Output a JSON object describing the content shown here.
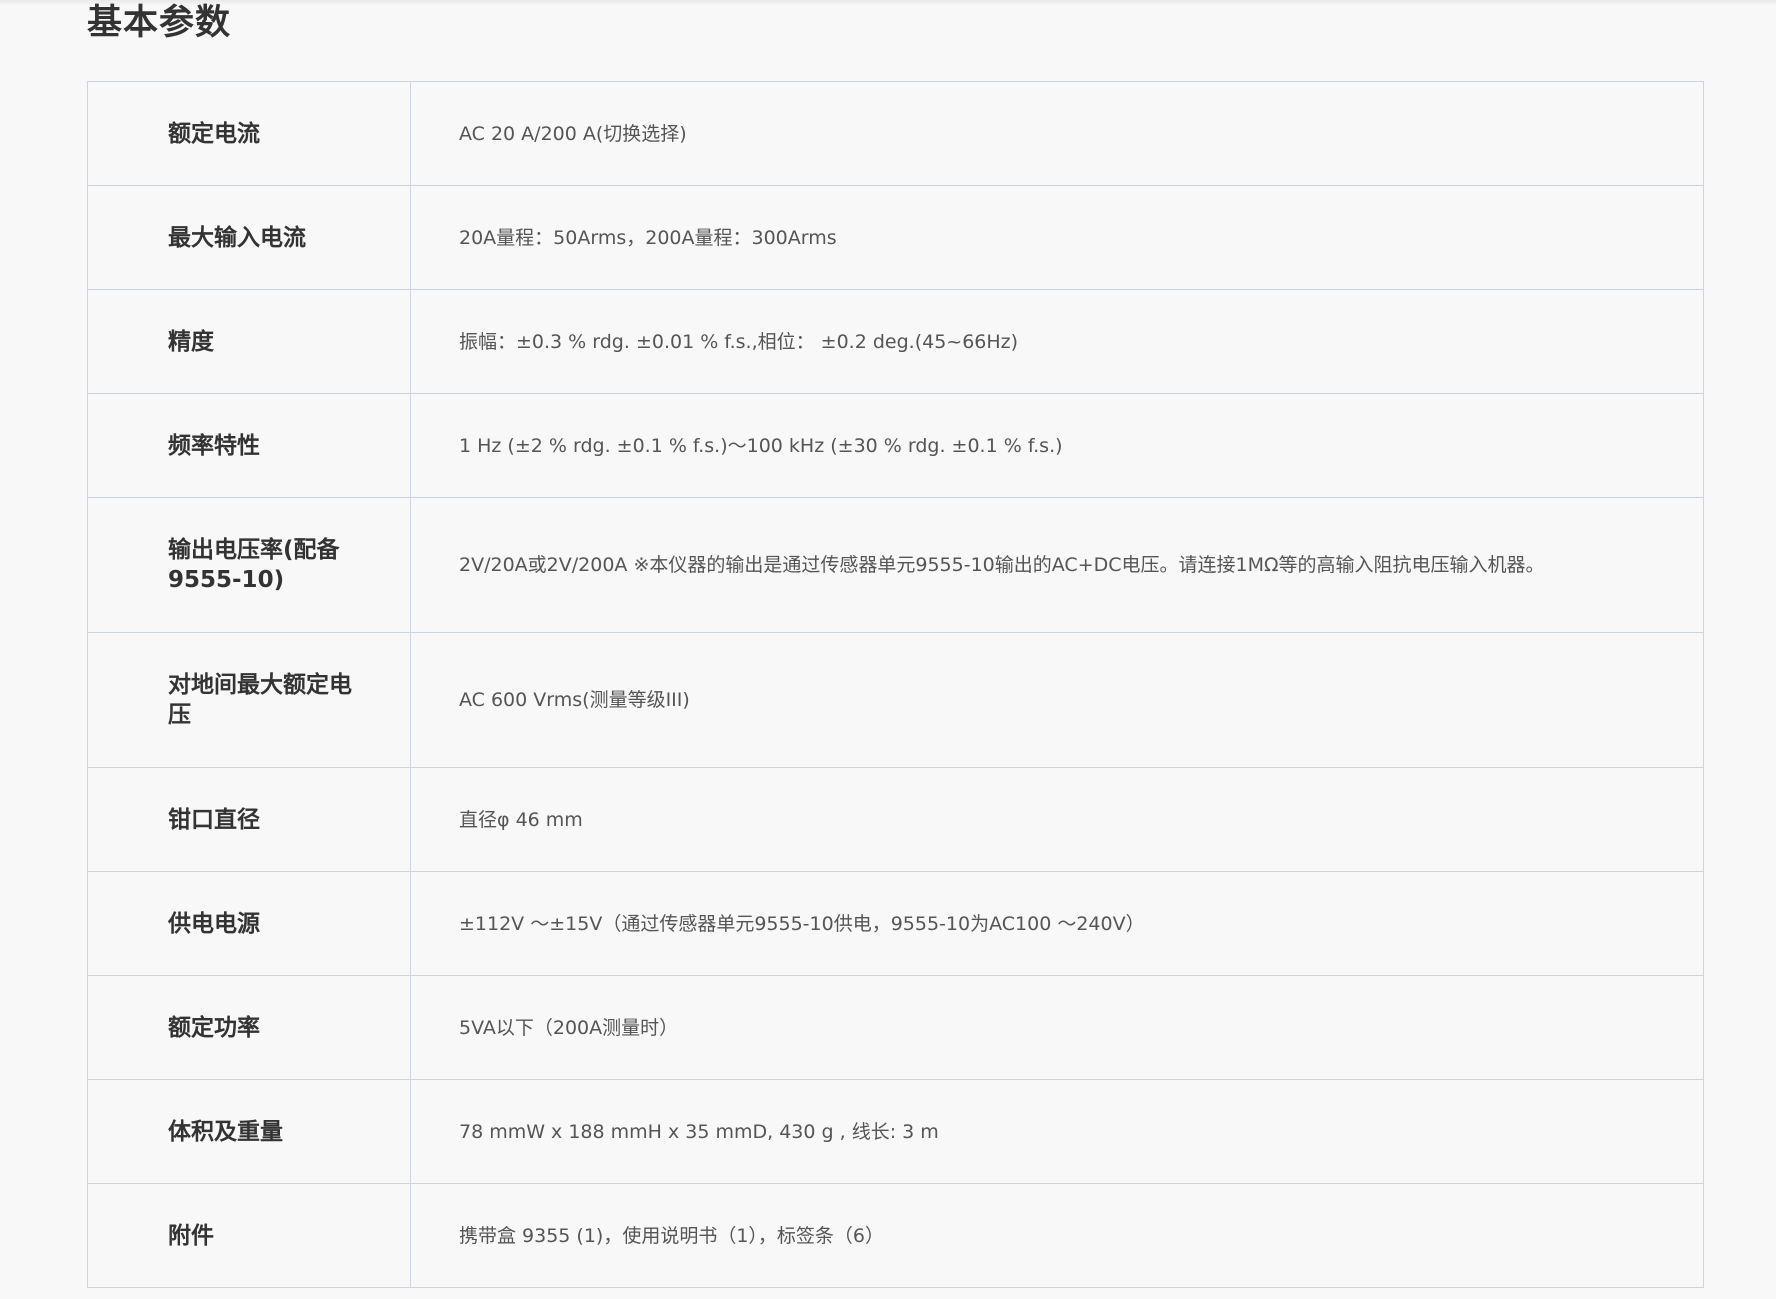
{
  "section": {
    "title": "基本参数"
  },
  "specs": [
    {
      "label": "额定电流",
      "value": "AC 20 A/200 A(切换选择)"
    },
    {
      "label": "最大输入电流",
      "value": "20A量程：50Arms，200A量程：300Arms"
    },
    {
      "label": "精度",
      "value": "振幅：±0.3 % rdg. ±0.01 % f.s.,相位： ±0.2 deg.(45~66Hz)"
    },
    {
      "label": "频率特性",
      "value": "1 Hz (±2 % rdg. ±0.1 % f.s.)～100 kHz (±30 % rdg. ±0.1 % f.s.)"
    },
    {
      "label": "输出电压率(配备9555-10)",
      "value": "2V/20A或2V/200A ※本仪器的输出是通过传感器单元9555-10输出的AC+DC电压。请连接1MΩ等的高输入阻抗电压输入机器。"
    },
    {
      "label": "对地间最大额定电压",
      "value": "AC 600 Vrms(测量等级III)"
    },
    {
      "label": "钳口直径",
      "value": "直径φ 46 mm"
    },
    {
      "label": "供电电源",
      "value": "±112V ～±15V（通过传感器单元9555-10供电，9555-10为AC100 ～240V）"
    },
    {
      "label": "额定功率",
      "value": "5VA以下（200A测量时）"
    },
    {
      "label": "体积及重量",
      "value": "78 mmW x 188 mmH x 35 mmD, 430 g , 线长: 3 m"
    },
    {
      "label": "附件",
      "value": "携带盒 9355 (1)，使用说明书（1），标签条（6）"
    }
  ]
}
